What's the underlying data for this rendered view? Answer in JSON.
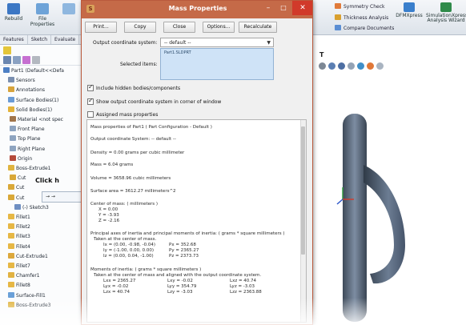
{
  "colors": {
    "dialog_title": "#c56a48",
    "selection_fill": "#cfe3f7",
    "part_body": "#4b5a6d"
  },
  "ribbon": {
    "left_buttons": [
      {
        "label": "Rebuild",
        "icon": "rebuild-icon"
      },
      {
        "label": "File\nProperties",
        "icon": "file-properties-icon"
      }
    ],
    "right_items": [
      {
        "label": "Symmetry Check",
        "icon": "symmetry-check-icon"
      },
      {
        "label": "Thickness Analysis",
        "icon": "thickness-analysis-icon"
      },
      {
        "label": "Compare Documents",
        "icon": "compare-documents-icon"
      }
    ],
    "right_tools": [
      {
        "label": "DFMXpress",
        "icon": "dfmxpress-icon"
      },
      {
        "label": "SimulationXpress Analysis Wizard",
        "icon": "simulationxpress-icon"
      }
    ]
  },
  "tabs": [
    "Features",
    "Sketch",
    "Evaluate"
  ],
  "tree": {
    "items": [
      {
        "label": "Part1 (Default<<Defa",
        "icon": "part-icon"
      },
      {
        "label": "Sensors",
        "icon": "sensor-icon"
      },
      {
        "label": "Annotations",
        "icon": "annotation-icon"
      },
      {
        "label": "Surface Bodies(1)",
        "icon": "surface-body-icon"
      },
      {
        "label": "Solid Bodies(1)",
        "icon": "solid-body-icon"
      },
      {
        "label": "Material <not spec",
        "icon": "material-icon"
      },
      {
        "label": "Front Plane",
        "icon": "plane-icon"
      },
      {
        "label": "Top Plane",
        "icon": "plane-icon"
      },
      {
        "label": "Right Plane",
        "icon": "plane-icon"
      },
      {
        "label": "Origin",
        "icon": "origin-icon"
      },
      {
        "label": "Boss-Extrude1",
        "icon": "extrude-icon"
      },
      {
        "label": "Cut",
        "icon": "cut-icon"
      },
      {
        "label": "Cut",
        "icon": "cut-icon"
      },
      {
        "label": "Cut",
        "icon": "cut-icon"
      },
      {
        "label": "(-) Sketch3",
        "icon": "sketch-icon"
      },
      {
        "label": "Fillet1",
        "icon": "fillet-icon"
      },
      {
        "label": "Fillet2",
        "icon": "fillet-icon"
      },
      {
        "label": "Fillet3",
        "icon": "fillet-icon"
      },
      {
        "label": "Fillet4",
        "icon": "fillet-icon"
      },
      {
        "label": "Cut-Extrude1",
        "icon": "cut-extrude-icon"
      },
      {
        "label": "Fillet7",
        "icon": "fillet-icon"
      },
      {
        "label": "Chamfer1",
        "icon": "chamfer-icon"
      },
      {
        "label": "Fillet8",
        "icon": "fillet-icon"
      },
      {
        "label": "Surface-Fill1",
        "icon": "surface-fill-icon"
      },
      {
        "label": "Boss-Extrude3",
        "icon": "extrude-icon"
      }
    ],
    "click_hint": "Click h",
    "popup_label": "→ →"
  },
  "graphics": {
    "viewport_label": "T"
  },
  "dialog": {
    "title": "Mass Properties",
    "app_icon_glyph": "S",
    "window_buttons": {
      "minimize": "–",
      "maximize": "□",
      "close": "✕"
    },
    "buttons": [
      "Print...",
      "Copy",
      "Close",
      "Options...",
      "Recalculate"
    ],
    "coord_label": "Output coordinate system:",
    "coord_value": "-- default --",
    "selected_items_label": "Selected items:",
    "selected_items_value": "Part1.SLDPRT",
    "checkboxes": [
      {
        "label": "Include hidden bodies/components",
        "checked": true
      },
      {
        "label": "Show output coordinate system in corner of window",
        "checked": true
      },
      {
        "label": "Assigned mass properties",
        "checked": false
      }
    ],
    "results": {
      "header": "Mass properties of Part1 ( Part Configuration - Default )",
      "coord_line": "Output coordinate System: -- default --",
      "density": "Density = 0.00 grams per cubic millimeter",
      "mass": "Mass = 6.04 grams",
      "volume": "Volume = 3658.96 cubic millimeters",
      "surface_area": "Surface area = 3612.27 millimeters^2",
      "center_of_mass_title": "Center of mass: ( millimeters )",
      "center_of_mass": [
        "X = 0.00",
        "Y = -3.93",
        "Z = -2.16"
      ],
      "principal_title": "Principal axes of inertia and principal moments of inertia: ( grams * square millimeters )",
      "principal_sub": "Taken at the center of mass.",
      "principal_rows": [
        {
          "axis": "Ix = (0.00, -0.98, -0.04)",
          "moment": "Px = 352.68"
        },
        {
          "axis": "Iy = (-1.00, 0.00, 0.00)",
          "moment": "Py = 2365.27"
        },
        {
          "axis": "Iz = (0.00, 0.04, -1.00)",
          "moment": "Pz = 2373.73"
        }
      ],
      "moments_title": "Moments of inertia: ( grams * square millimeters )",
      "moments_sub": "Taken at the center of mass and aligned with the output coordinate system.",
      "moments_rows": [
        [
          "Lxx = 2365.27",
          "Lxy = -0.02",
          "Lxz = 40.74"
        ],
        [
          "Lyx = -0.02",
          "Lyy = 354.79",
          "Lyz = -3.03"
        ],
        [
          "Lzx = 40.74",
          "Lzy = -3.03",
          "Lzz = 2363.88"
        ]
      ]
    }
  }
}
